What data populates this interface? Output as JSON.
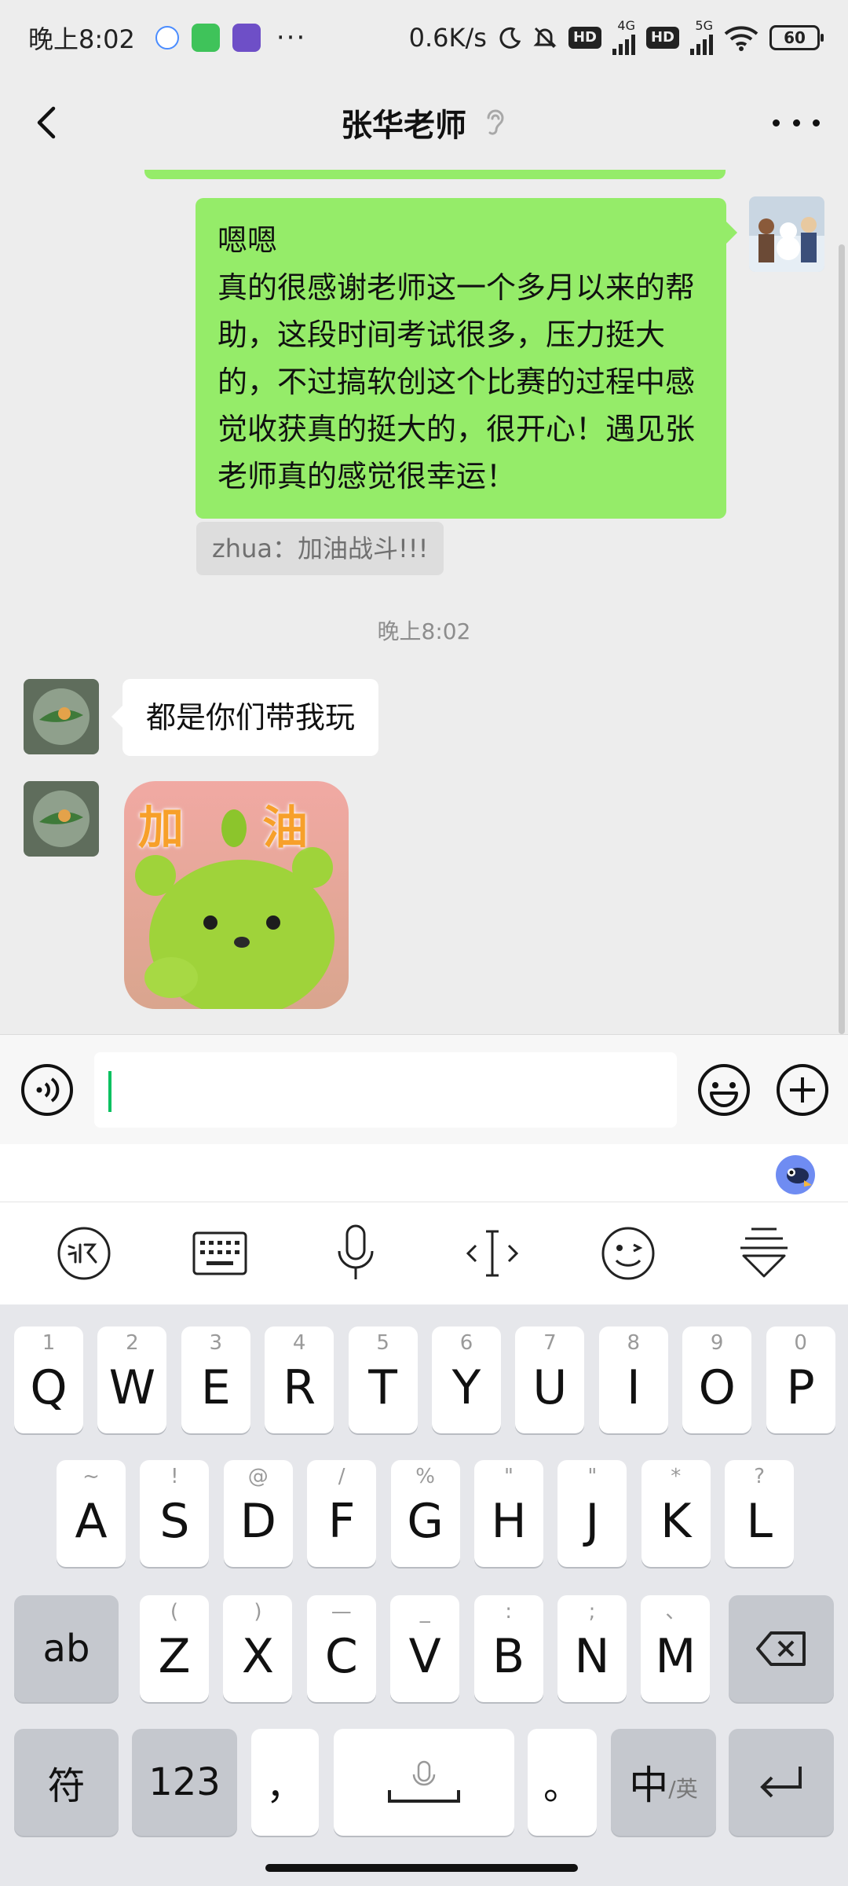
{
  "status_bar": {
    "time": "晚上8:02",
    "dots": "···",
    "net_speed": "0.6K/s",
    "hd1": "HD",
    "net1": "4G",
    "hd2": "HD",
    "net2": "5G",
    "battery": "60"
  },
  "header": {
    "title": "张华老师"
  },
  "messages": {
    "sent_text": "嗯嗯\n真的很感谢老师这一个多月以来的帮助，这段时间考试很多，压力挺大的，不过搞软创这个比赛的过程中感觉收获真的挺大的，很开心！遇见张老师真的感觉很幸运！",
    "quote_text": "zhua：加油战斗!!!",
    "timestamp": "晚上8:02",
    "received_text": "都是你们带我玩",
    "sticker_text": "加 油"
  },
  "keyboard": {
    "row1": [
      {
        "main": "Q",
        "sub": "1"
      },
      {
        "main": "W",
        "sub": "2"
      },
      {
        "main": "E",
        "sub": "3"
      },
      {
        "main": "R",
        "sub": "4"
      },
      {
        "main": "T",
        "sub": "5"
      },
      {
        "main": "Y",
        "sub": "6"
      },
      {
        "main": "U",
        "sub": "7"
      },
      {
        "main": "I",
        "sub": "8"
      },
      {
        "main": "O",
        "sub": "9"
      },
      {
        "main": "P",
        "sub": "0"
      }
    ],
    "row2": [
      {
        "main": "A",
        "sub": "~"
      },
      {
        "main": "S",
        "sub": "!"
      },
      {
        "main": "D",
        "sub": "@"
      },
      {
        "main": "F",
        "sub": "/"
      },
      {
        "main": "G",
        "sub": "%"
      },
      {
        "main": "H",
        "sub": "\""
      },
      {
        "main": "J",
        "sub": "\""
      },
      {
        "main": "K",
        "sub": "*"
      },
      {
        "main": "L",
        "sub": "?"
      }
    ],
    "row3": [
      {
        "main": "Z",
        "sub": "("
      },
      {
        "main": "X",
        "sub": ")"
      },
      {
        "main": "C",
        "sub": "—"
      },
      {
        "main": "V",
        "sub": "_"
      },
      {
        "main": "B",
        "sub": ":"
      },
      {
        "main": "N",
        "sub": ";"
      },
      {
        "main": "M",
        "sub": "、"
      }
    ],
    "shift_label": "ab",
    "symbol_label": "符",
    "num_label": "123",
    "comma_label": "，",
    "period_label": "。",
    "lang_main": "中",
    "lang_sub": "/英"
  },
  "icons": {
    "back": "chevron-left-icon",
    "ear": "ear-icon",
    "more": "more-dots-icon",
    "voice": "voice-icon",
    "emoji": "emoji-icon",
    "plus": "plus-icon",
    "delete": "backspace-icon",
    "enter": "enter-icon"
  },
  "colors": {
    "sent_bubble": "#95ec69",
    "caret": "#07c160",
    "background": "#ededed"
  }
}
